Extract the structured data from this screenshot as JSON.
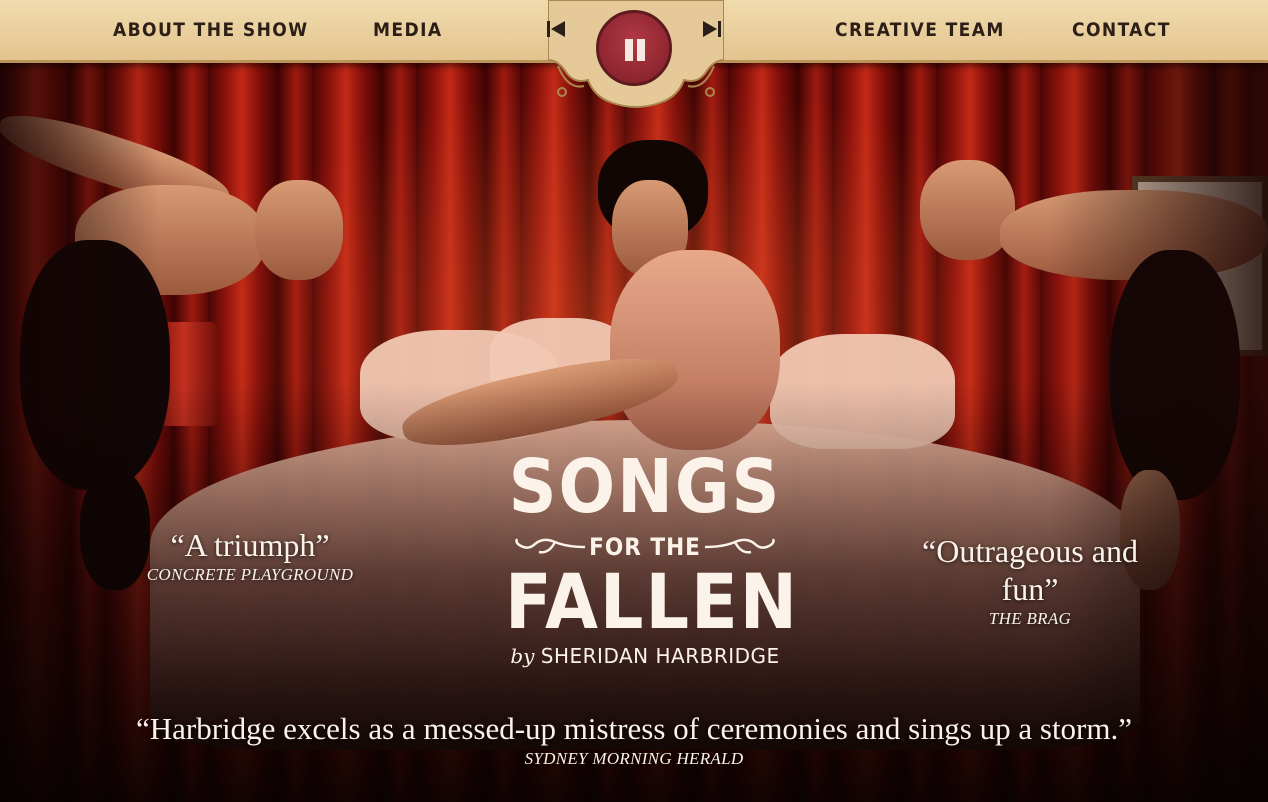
{
  "nav": {
    "left_items": [
      {
        "label": "ABOUT THE SHOW"
      },
      {
        "label": "MEDIA"
      }
    ],
    "right_items": [
      {
        "label": "CREATIVE TEAM"
      },
      {
        "label": "CONTACT"
      }
    ]
  },
  "player": {
    "prev_icon": "skip-previous-icon",
    "pause_icon": "pause-icon",
    "next_icon": "skip-next-icon",
    "accent_color": "#8e2330"
  },
  "logo": {
    "line1": "SONGS",
    "line2": "FOR THE",
    "line3": "FALLEN",
    "by": "by",
    "author": "SHERIDAN HARBRIDGE"
  },
  "quotes": [
    {
      "text": "“A triumph”",
      "source": "CONCRETE PLAYGROUND"
    },
    {
      "text": "“Outrageous and fun”",
      "source": "THE BRAG"
    },
    {
      "text": "“Harbridge excels as a messed-up mistress of ceremonies and sings up a storm.”",
      "source": "SYDNEY MORNING HERALD"
    }
  ],
  "colors": {
    "nav_background": "#e9cf9c",
    "nav_text": "#2c1f18",
    "curtain_red": "#a01a10",
    "text_light": "#fbf3ea"
  }
}
